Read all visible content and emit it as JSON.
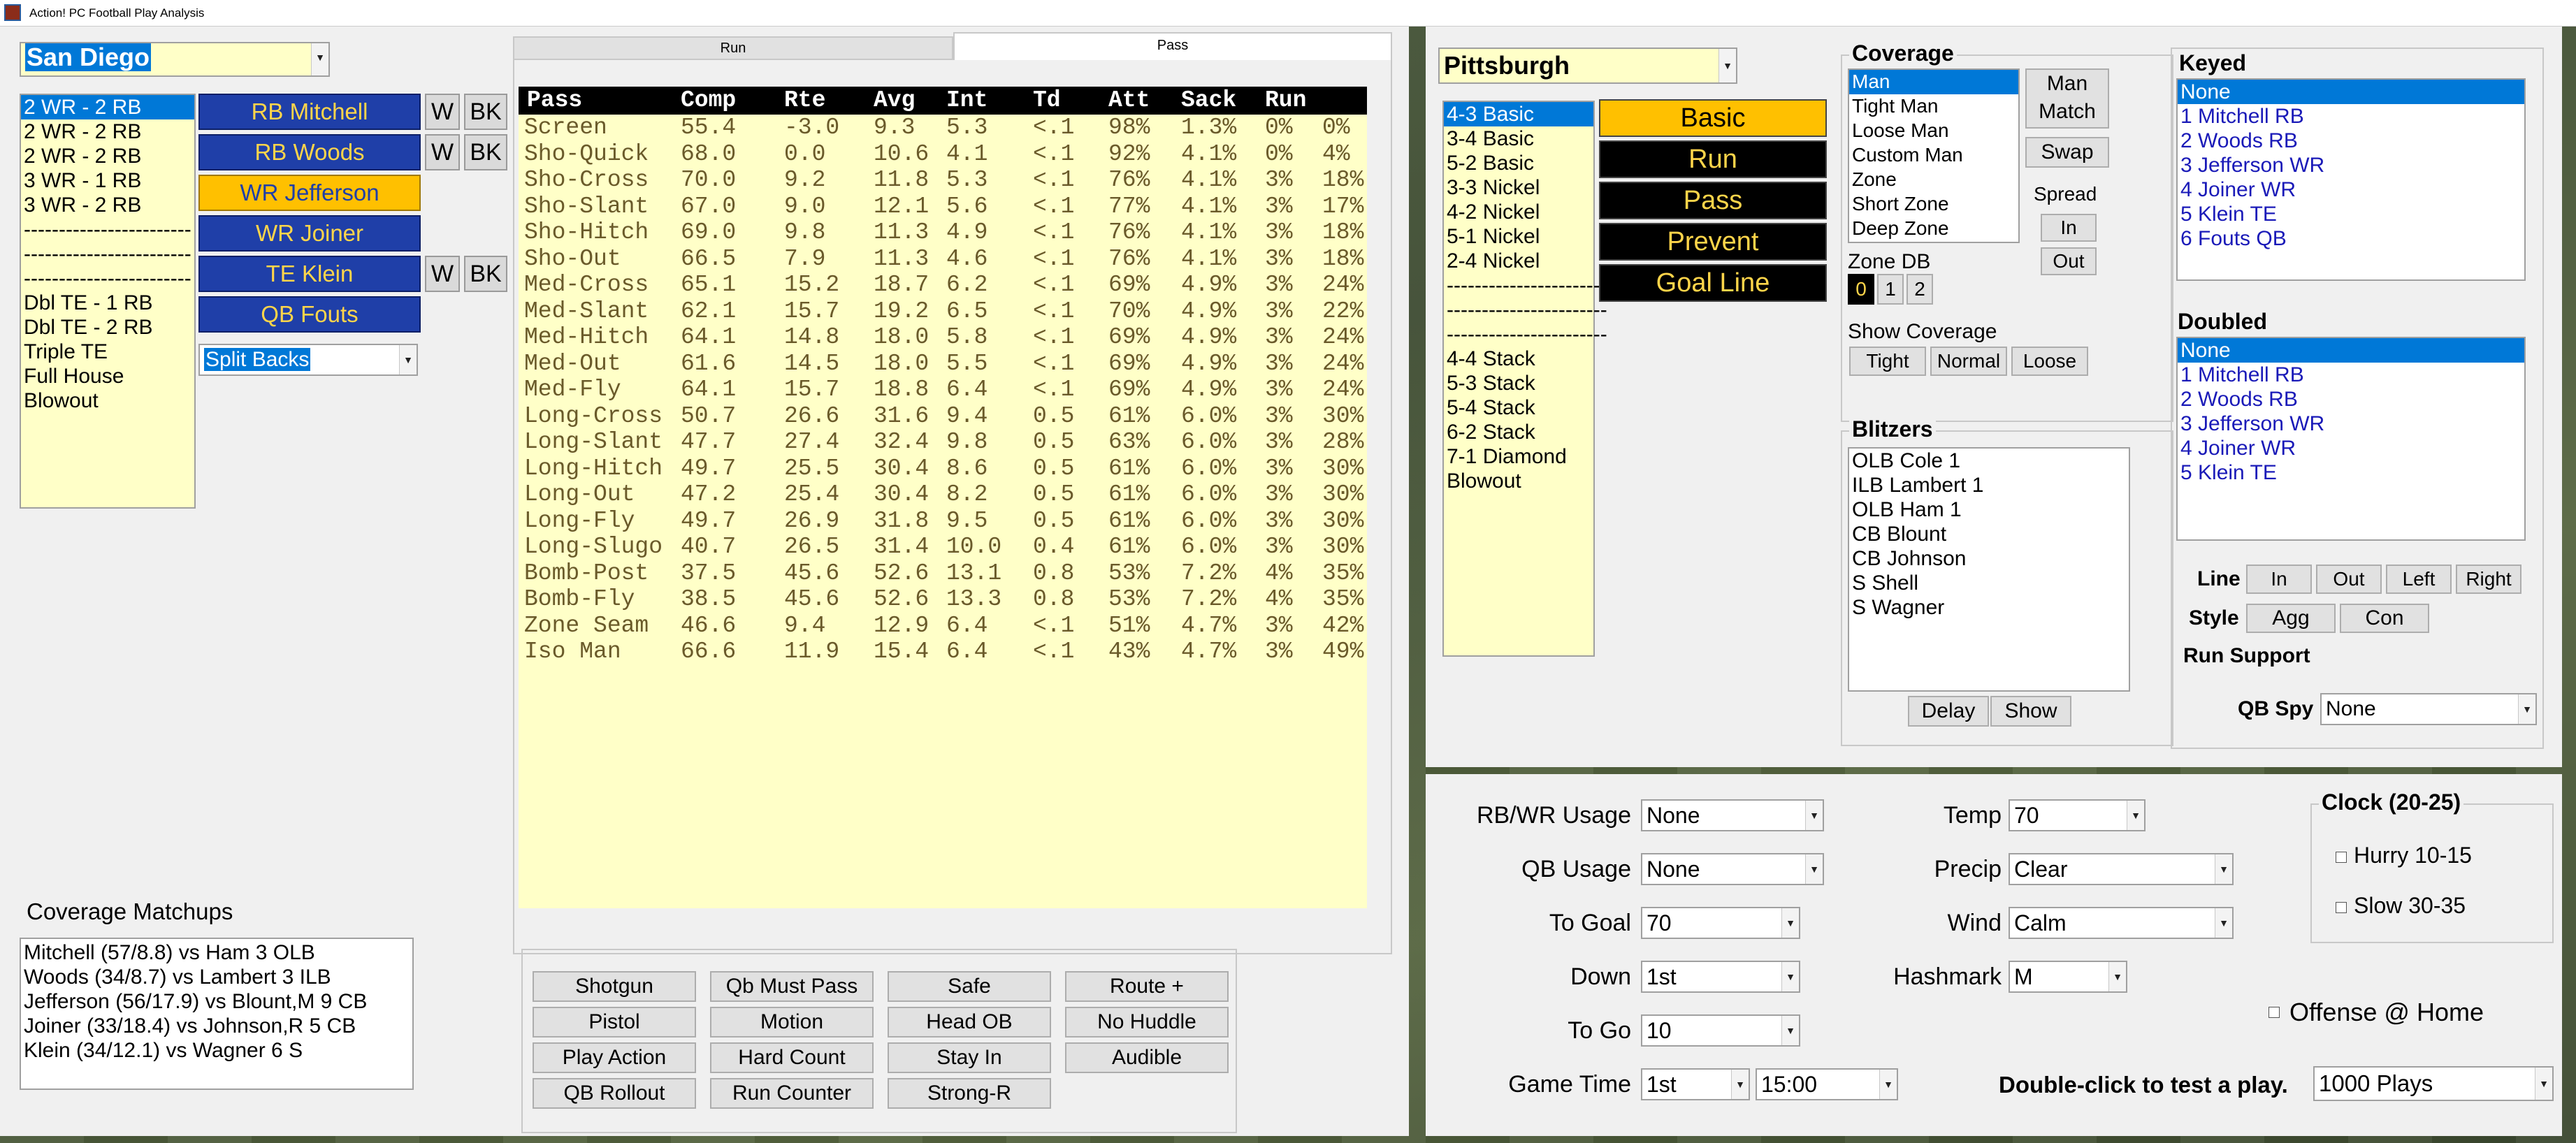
{
  "window": {
    "title": "Action! PC Football Play Analysis"
  },
  "offense": {
    "team": "San Diego",
    "formations": {
      "items": [
        "2 WR - 2 RB",
        "2 WR - 2 RB",
        "2 WR - 2 RB",
        "3 WR - 1 RB",
        "3 WR - 2 RB",
        "------------------------",
        "------------------------",
        "------------------------",
        "Dbl TE - 1 RB",
        "Dbl TE - 2 RB",
        "Triple TE",
        "Full House",
        "Blowout"
      ],
      "selected": 0
    },
    "players": [
      {
        "label": "RB Mitchell",
        "w": "W",
        "bk": "BK",
        "active": false
      },
      {
        "label": "RB Woods",
        "w": "W",
        "bk": "BK",
        "active": false
      },
      {
        "label": "WR Jefferson",
        "active": true
      },
      {
        "label": "WR Joiner",
        "active": false
      },
      {
        "label": "TE Klein",
        "w": "W",
        "bk": "BK",
        "active": false
      },
      {
        "label": "QB Fouts",
        "active": false
      }
    ],
    "backfield": "Split Backs",
    "coverage_matchups": {
      "title": "Coverage Matchups",
      "items": [
        "Mitchell (57/8.8) vs Ham 3 OLB",
        "Woods (34/8.7) vs Lambert 3 ILB",
        "Jefferson (56/17.9) vs Blount,M 9 CB",
        "Joiner (33/18.4) vs Johnson,R 5 CB",
        "Klein (34/12.1) vs Wagner 6 S"
      ]
    }
  },
  "plays": {
    "tabs": [
      "Run",
      "Pass"
    ],
    "active_tab": "Pass",
    "columns": [
      "Pass",
      "Comp",
      "Rte",
      "Avg",
      "Int",
      "Td",
      "Att",
      "Sack",
      "Run"
    ],
    "rows": [
      [
        "Screen",
        "55.4",
        "-3.0",
        "9.3",
        "5.3",
        "<.1",
        "98%",
        "1.3%",
        "0%",
        "0%"
      ],
      [
        "Sho-Quick",
        "68.0",
        "0.0",
        "10.6",
        "4.1",
        "<.1",
        "92%",
        "4.1%",
        "0%",
        "4%"
      ],
      [
        "Sho-Cross",
        "70.0",
        "9.2",
        "11.8",
        "5.3",
        "<.1",
        "76%",
        "4.1%",
        "3%",
        "18%"
      ],
      [
        "Sho-Slant",
        "67.0",
        "9.0",
        "12.1",
        "5.6",
        "<.1",
        "77%",
        "4.1%",
        "3%",
        "17%"
      ],
      [
        "Sho-Hitch",
        "69.0",
        "9.8",
        "11.3",
        "4.9",
        "<.1",
        "76%",
        "4.1%",
        "3%",
        "18%"
      ],
      [
        "Sho-Out",
        "66.5",
        "7.9",
        "11.3",
        "4.6",
        "<.1",
        "76%",
        "4.1%",
        "3%",
        "18%"
      ],
      [
        "Med-Cross",
        "65.1",
        "15.2",
        "18.7",
        "6.2",
        "<.1",
        "69%",
        "4.9%",
        "3%",
        "24%"
      ],
      [
        "Med-Slant",
        "62.1",
        "15.7",
        "19.2",
        "6.5",
        "<.1",
        "70%",
        "4.9%",
        "3%",
        "22%"
      ],
      [
        "Med-Hitch",
        "64.1",
        "14.8",
        "18.0",
        "5.8",
        "<.1",
        "69%",
        "4.9%",
        "3%",
        "24%"
      ],
      [
        "Med-Out",
        "61.6",
        "14.5",
        "18.0",
        "5.5",
        "<.1",
        "69%",
        "4.9%",
        "3%",
        "24%"
      ],
      [
        "Med-Fly",
        "64.1",
        "15.7",
        "18.8",
        "6.4",
        "<.1",
        "69%",
        "4.9%",
        "3%",
        "24%"
      ],
      [
        "Long-Cross",
        "50.7",
        "26.6",
        "31.6",
        "9.4",
        "0.5",
        "61%",
        "6.0%",
        "3%",
        "30%"
      ],
      [
        "Long-Slant",
        "47.7",
        "27.4",
        "32.4",
        "9.8",
        "0.5",
        "63%",
        "6.0%",
        "3%",
        "28%"
      ],
      [
        "Long-Hitch",
        "49.7",
        "25.5",
        "30.4",
        "8.6",
        "0.5",
        "61%",
        "6.0%",
        "3%",
        "30%"
      ],
      [
        "Long-Out",
        "47.2",
        "25.4",
        "30.4",
        "8.2",
        "0.5",
        "61%",
        "6.0%",
        "3%",
        "30%"
      ],
      [
        "Long-Fly",
        "49.7",
        "26.9",
        "31.8",
        "9.5",
        "0.5",
        "61%",
        "6.0%",
        "3%",
        "30%"
      ],
      [
        "Long-Slugo",
        "40.7",
        "26.5",
        "31.4",
        "10.0",
        "0.4",
        "61%",
        "6.0%",
        "3%",
        "30%"
      ],
      [
        "Bomb-Post",
        "37.5",
        "45.6",
        "52.6",
        "13.1",
        "0.8",
        "53%",
        "7.2%",
        "4%",
        "35%"
      ],
      [
        "Bomb-Fly",
        "38.5",
        "45.6",
        "52.6",
        "13.3",
        "0.8",
        "53%",
        "7.2%",
        "4%",
        "35%"
      ],
      [
        "Zone Seam",
        "46.6",
        "9.4",
        "12.9",
        "6.4",
        "<.1",
        "51%",
        "4.7%",
        "3%",
        "42%"
      ],
      [
        "Iso Man",
        "66.6",
        "11.9",
        "15.4",
        "6.4",
        "<.1",
        "43%",
        "4.7%",
        "3%",
        "49%"
      ]
    ]
  },
  "options": [
    [
      "Shotgun",
      "Qb Must Pass",
      "Safe",
      "Route +"
    ],
    [
      "Pistol",
      "Motion",
      "Head OB",
      "No Huddle"
    ],
    [
      "Play Action",
      "Hard Count",
      "Stay In",
      "Audible"
    ],
    [
      "QB Rollout",
      "Run Counter",
      "Strong-R"
    ]
  ],
  "defense": {
    "team": "Pittsburgh",
    "formations": {
      "items": [
        "4-3 Basic",
        "3-4 Basic",
        "5-2 Basic",
        "3-3 Nickel",
        "4-2 Nickel",
        "5-1 Nickel",
        "2-4 Nickel",
        "-----------------------",
        "-----------------------",
        "-----------------------",
        "4-4 Stack",
        "5-3 Stack",
        "5-4 Stack",
        "6-2 Stack",
        "7-1 Diamond",
        "Blowout"
      ],
      "selected": 0
    },
    "types": [
      "Basic",
      "Run",
      "Pass",
      "Prevent",
      "Goal Line"
    ],
    "active_type": "Basic",
    "coverage": {
      "title": "Coverage",
      "items": [
        "Man",
        "Tight Man",
        "Loose Man",
        "Custom Man",
        "Zone",
        "Short Zone",
        "Deep Zone"
      ],
      "selected": 0,
      "man_match": "Man Match",
      "swap": "Swap",
      "spread": "Spread",
      "in": "In",
      "out": "Out",
      "zone_db": "Zone DB",
      "zone_db_values": [
        "0",
        "1",
        "2"
      ],
      "show_coverage": "Show Coverage",
      "show_buttons": [
        "Tight",
        "Normal",
        "Loose"
      ]
    },
    "blitzers": {
      "title": "Blitzers",
      "items": [
        "OLB Cole  1",
        "ILB Lambert  1",
        "OLB Ham  1",
        "CB Blount",
        "CB Johnson",
        "S Shell",
        "S Wagner"
      ],
      "delay": "Delay",
      "show": "Show"
    },
    "keyed": {
      "title": "Keyed",
      "items": [
        "None",
        "1 Mitchell RB",
        "2 Woods RB",
        "3 Jefferson WR",
        "4 Joiner WR",
        "5 Klein TE",
        "6 Fouts QB"
      ],
      "selected": 0
    },
    "doubled": {
      "title": "Doubled",
      "items": [
        "None",
        "1 Mitchell RB",
        "2 Woods RB",
        "3 Jefferson WR",
        "4 Joiner WR",
        "5 Klein TE"
      ],
      "selected": 0
    },
    "line": {
      "label": "Line",
      "buttons": [
        "In",
        "Out",
        "Left",
        "Right"
      ]
    },
    "style": {
      "label": "Style",
      "buttons": [
        "Agg",
        "Con"
      ]
    },
    "run_support": "Run Support",
    "qb_spy": {
      "label": "QB Spy",
      "value": "None"
    }
  },
  "situation": {
    "rb_wr_usage": {
      "label": "RB/WR Usage",
      "value": "None"
    },
    "qb_usage": {
      "label": "QB Usage",
      "value": "None"
    },
    "to_goal": {
      "label": "To Goal",
      "value": "70"
    },
    "down": {
      "label": "Down",
      "value": "1st"
    },
    "to_go": {
      "label": "To Go",
      "value": "10"
    },
    "game_time": {
      "label": "Game Time",
      "quarter": "1st",
      "clock": "15:00"
    },
    "temp": {
      "label": "Temp",
      "value": "70"
    },
    "precip": {
      "label": "Precip",
      "value": "Clear"
    },
    "wind": {
      "label": "Wind",
      "value": "Calm"
    },
    "hashmark": {
      "label": "Hashmark",
      "value": "M"
    },
    "clock": {
      "title": "Clock (20-25)",
      "hurry": "Hurry 10-15",
      "slow": "Slow 30-35"
    },
    "offense_home": "Offense @ Home",
    "test_hint": "Double-click to test a play.",
    "plays_count": "1000 Plays"
  }
}
